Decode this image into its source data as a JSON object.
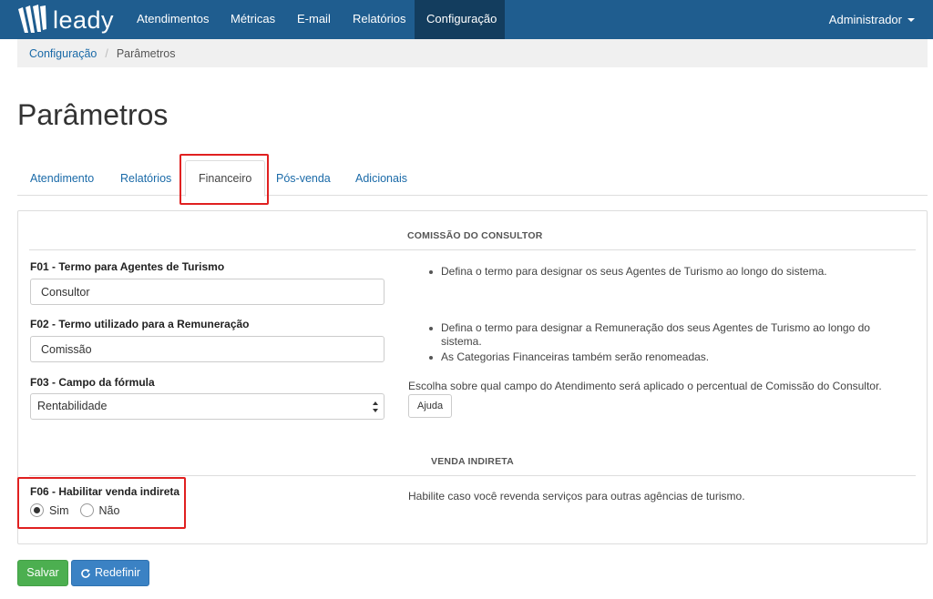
{
  "brand": {
    "name": "leady"
  },
  "nav": {
    "items": [
      {
        "label": "Atendimentos"
      },
      {
        "label": "Métricas"
      },
      {
        "label": "E-mail"
      },
      {
        "label": "Relatórios"
      },
      {
        "label": "Configuração"
      }
    ],
    "active": "Configuração",
    "user": "Administrador"
  },
  "breadcrumb": {
    "parent": "Configuração",
    "separator": "/",
    "current": "Parâmetros"
  },
  "page": {
    "title": "Parâmetros"
  },
  "tabs": [
    {
      "label": "Atendimento"
    },
    {
      "label": "Relatórios"
    },
    {
      "label": "Financeiro"
    },
    {
      "label": "Pós-venda"
    },
    {
      "label": "Adicionais"
    }
  ],
  "active_tab": "Financeiro",
  "sections": {
    "commission": {
      "title": "COMISSÃO DO CONSULTOR",
      "f01": {
        "label": "F01 - Termo para Agentes de Turismo",
        "value": "Consultor",
        "help": [
          "Defina o termo para designar os seus Agentes de Turismo ao longo do sistema."
        ]
      },
      "f02": {
        "label": "F02 - Termo utilizado para a Remuneração",
        "value": "Comissão",
        "help": [
          "Defina o termo para designar a Remuneração dos seus Agentes de Turismo ao longo do sistema.",
          "As Categorias Financeiras também serão renomeadas."
        ]
      },
      "f03": {
        "label": "F03 - Campo da fórmula",
        "selected": "Rentabilidade",
        "help": "Escolha sobre qual campo do Atendimento será aplicado o percentual de Comissão do Consultor.",
        "help_button": "Ajuda"
      }
    },
    "indirect": {
      "title": "VENDA INDIRETA",
      "f06": {
        "label": "F06 - Habilitar venda indireta",
        "options": [
          "Sim",
          "Não"
        ],
        "selected": "Sim",
        "help": "Habilite caso você revenda serviços para outras agências de turismo."
      }
    }
  },
  "actions": {
    "save": "Salvar",
    "reset": "Redefinir"
  },
  "colors": {
    "navbar": "#1f5d8f",
    "nav_active": "#133d5e",
    "link": "#1a6aa8",
    "save": "#4caf50",
    "reset": "#3b82c4",
    "highlight": "#e02020"
  }
}
